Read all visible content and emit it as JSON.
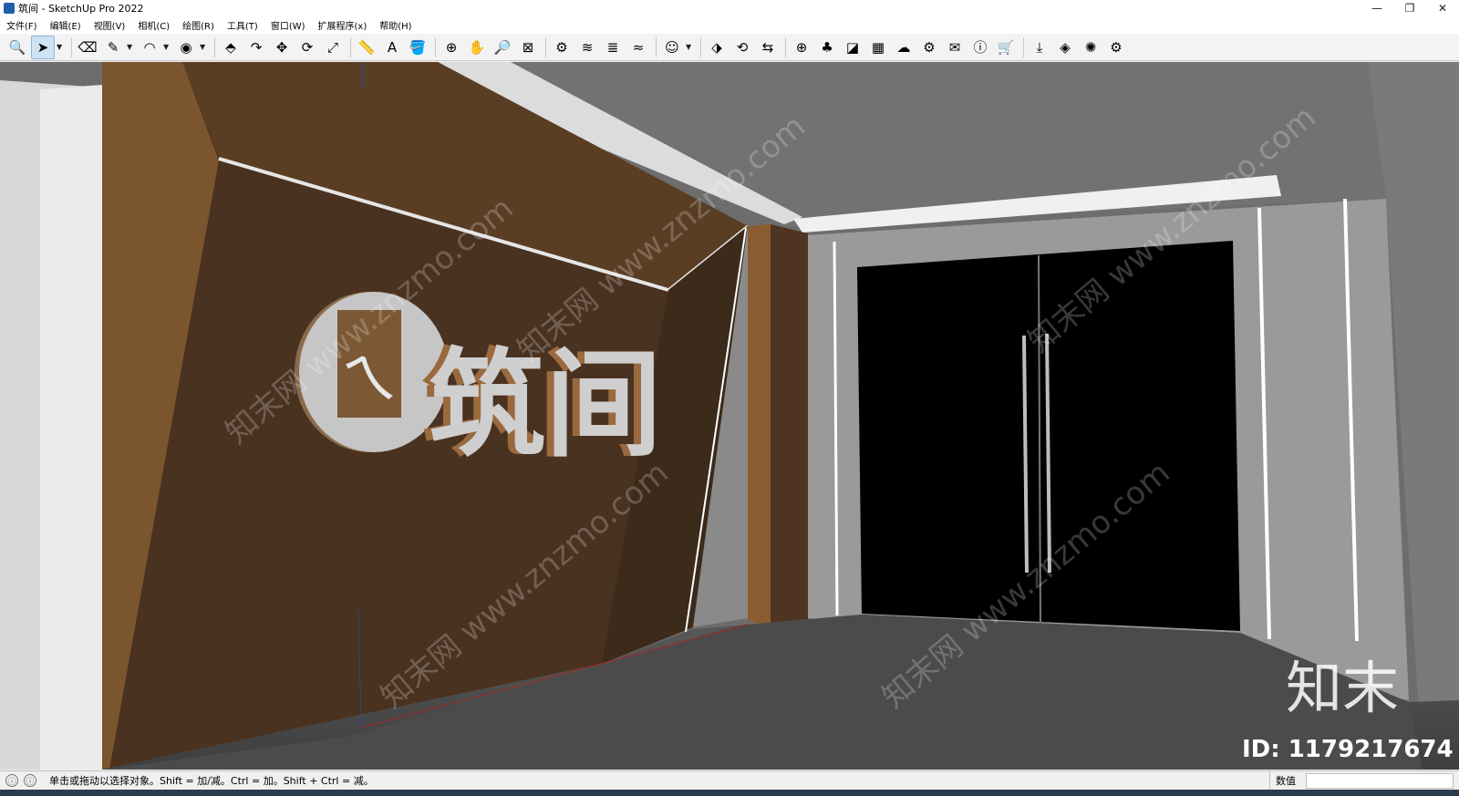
{
  "window": {
    "title": "筑间 - SketchUp Pro 2022",
    "minimize_glyph": "—",
    "maximize_glyph": "❐",
    "close_glyph": "✕"
  },
  "menu": [
    "文件(F)",
    "编辑(E)",
    "视图(V)",
    "相机(C)",
    "绘图(R)",
    "工具(T)",
    "窗口(W)",
    "扩展程序(x)",
    "帮助(H)"
  ],
  "toolbar": {
    "tools": [
      {
        "name": "zoom-extents-icon",
        "glyph": "🔍"
      },
      {
        "name": "select-icon",
        "glyph": "➤",
        "active": true
      },
      {
        "name": "eraser-icon",
        "glyph": "⌫"
      },
      {
        "name": "pencil-icon",
        "glyph": "✎"
      },
      {
        "name": "arc-icon",
        "glyph": "◠"
      },
      {
        "name": "shapes-icon",
        "glyph": "◉"
      },
      {
        "name": "push-pull-icon",
        "glyph": "⬘"
      },
      {
        "name": "follow-me-icon",
        "glyph": "↷"
      },
      {
        "name": "move-icon",
        "glyph": "✥"
      },
      {
        "name": "rotate-icon",
        "glyph": "⟳"
      },
      {
        "name": "scale-icon",
        "glyph": "⤢"
      },
      {
        "name": "tape-measure-icon",
        "glyph": "📏"
      },
      {
        "name": "text-icon",
        "glyph": "A"
      },
      {
        "name": "paint-bucket-icon",
        "glyph": "🪣"
      },
      {
        "name": "orbit-icon",
        "glyph": "⊕"
      },
      {
        "name": "pan-icon",
        "glyph": "✋"
      },
      {
        "name": "zoom-icon",
        "glyph": "🔎"
      },
      {
        "name": "zoom-window-icon",
        "glyph": "⊠"
      },
      {
        "name": "warehouse-icon",
        "glyph": "⚙"
      },
      {
        "name": "extension-icon",
        "glyph": "≋"
      },
      {
        "name": "layers-icon",
        "glyph": "≣"
      },
      {
        "name": "sandbox-icon",
        "glyph": "≈"
      },
      {
        "name": "profile-icon",
        "glyph": "☺"
      },
      {
        "name": "builder-icon",
        "glyph": "⬗"
      },
      {
        "name": "sync-icon",
        "glyph": "⟲"
      },
      {
        "name": "export-icon",
        "glyph": "⇆"
      },
      {
        "name": "add-icon",
        "glyph": "⊕"
      },
      {
        "name": "tree-icon",
        "glyph": "♣"
      },
      {
        "name": "photo-icon",
        "glyph": "◪"
      },
      {
        "name": "checker-icon",
        "glyph": "▦"
      },
      {
        "name": "cloud-icon",
        "glyph": "☁"
      },
      {
        "name": "settings-icon",
        "glyph": "⚙"
      },
      {
        "name": "mail-icon",
        "glyph": "✉"
      },
      {
        "name": "info-icon",
        "glyph": "ⓘ"
      },
      {
        "name": "cart-icon",
        "glyph": "🛒"
      },
      {
        "name": "import-icon",
        "glyph": "⤓"
      },
      {
        "name": "layout-icon",
        "glyph": "◈"
      },
      {
        "name": "render-icon",
        "glyph": "✺"
      },
      {
        "name": "gear-group-icon",
        "glyph": "⚙"
      }
    ]
  },
  "scene": {
    "logo_text": "筑间",
    "logo_glyph": "ㄟ",
    "watermark": "知末网 www.znzmo.com",
    "brand_big": "知末",
    "brand_id": "ID: 1179217674"
  },
  "status": {
    "text": "单击或拖动以选择对象。Shift = 加/减。Ctrl = 加。Shift + Ctrl = 减。",
    "measure_label": "数值",
    "info_glyph": "ⓘ"
  }
}
